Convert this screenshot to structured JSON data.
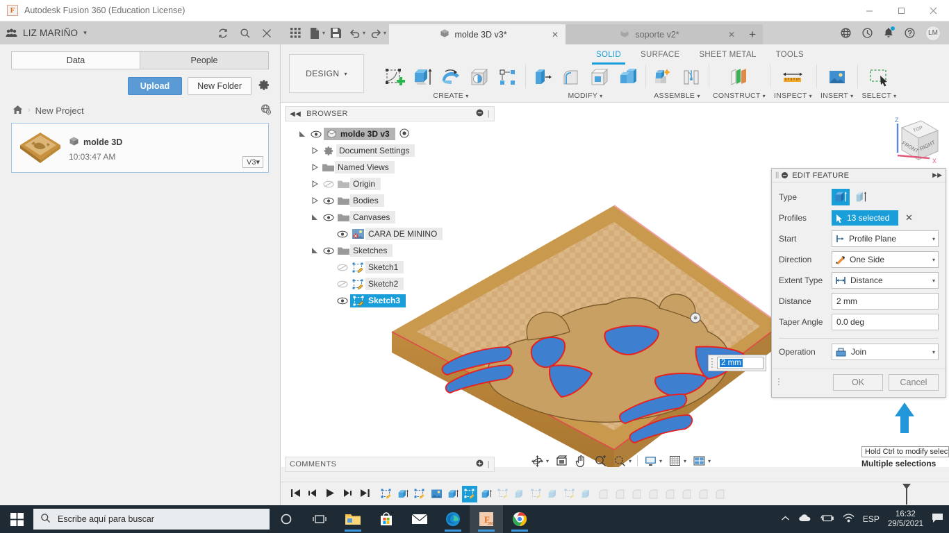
{
  "titlebar": {
    "app_title": "Autodesk Fusion 360 (Education License)",
    "logo_letter": "F",
    "minimize": "–",
    "maximize": "□",
    "close": "✕"
  },
  "data_panel": {
    "user_name": "LIZ MARIÑO",
    "caret": "▾",
    "tabs": [
      {
        "label": "Data",
        "active": true
      },
      {
        "label": "People",
        "active": false
      }
    ],
    "upload_label": "Upload",
    "new_folder_label": "New Folder",
    "breadcrumb": {
      "home_icon": "home-icon",
      "separator": "›",
      "project": "New Project"
    },
    "file": {
      "name": "molde 3D",
      "time": "10:03:47 AM",
      "version": "V3",
      "version_caret": "▾"
    }
  },
  "doc_tabs": {
    "tabs": [
      {
        "label": "molde 3D v3*",
        "active": true,
        "close": "✕"
      },
      {
        "label": "soporte v2*",
        "active": false,
        "close": "✕"
      }
    ],
    "add_tab": "+",
    "avatar_initials": "LM"
  },
  "ribbon": {
    "design_label": "DESIGN",
    "design_caret": "▾",
    "workspace_tabs": [
      {
        "label": "SOLID",
        "active": true
      },
      {
        "label": "SURFACE",
        "active": false
      },
      {
        "label": "SHEET METAL",
        "active": false
      },
      {
        "label": "TOOLS",
        "active": false
      }
    ],
    "groups": [
      {
        "label": "CREATE",
        "caret": "▾"
      },
      {
        "label": "MODIFY",
        "caret": "▾"
      },
      {
        "label": "ASSEMBLE",
        "caret": "▾"
      },
      {
        "label": "CONSTRUCT",
        "caret": "▾"
      },
      {
        "label": "INSPECT",
        "caret": "▾"
      },
      {
        "label": "INSERT",
        "caret": "▾"
      },
      {
        "label": "SELECT",
        "caret": "▾"
      }
    ]
  },
  "browser": {
    "title": "BROWSER",
    "collapse_icon": "◀◀",
    "nodes": [
      {
        "label": "molde 3D v3",
        "indent": 0,
        "state": "selected-gray"
      },
      {
        "label": "Document Settings",
        "indent": 1,
        "state": "normal"
      },
      {
        "label": "Named Views",
        "indent": 1,
        "state": "normal"
      },
      {
        "label": "Origin",
        "indent": 1,
        "state": "hidden"
      },
      {
        "label": "Bodies",
        "indent": 1,
        "state": "normal"
      },
      {
        "label": "Canvases",
        "indent": 1,
        "state": "normal"
      },
      {
        "label": "CARA DE MININO",
        "indent": 2,
        "state": "normal"
      },
      {
        "label": "Sketches",
        "indent": 1,
        "state": "normal"
      },
      {
        "label": "Sketch1",
        "indent": 2,
        "state": "hidden"
      },
      {
        "label": "Sketch2",
        "indent": 2,
        "state": "hidden"
      },
      {
        "label": "Sketch3",
        "indent": 2,
        "state": "selected-blue"
      }
    ]
  },
  "comments": {
    "title": "COMMENTS",
    "add_icon": "+"
  },
  "dialog": {
    "title": "EDIT FEATURE",
    "expand_icon": "▶▶",
    "rows": {
      "type_label": "Type",
      "profiles_label": "Profiles",
      "profiles_value": "13 selected",
      "profiles_clear": "✕",
      "start_label": "Start",
      "start_value": "Profile Plane",
      "direction_label": "Direction",
      "direction_value": "One Side",
      "extent_label": "Extent Type",
      "extent_value": "Distance",
      "distance_label": "Distance",
      "distance_value": "2 mm",
      "taper_label": "Taper Angle",
      "taper_value": "0.0 deg",
      "operation_label": "Operation",
      "operation_value": "Join"
    },
    "ok_label": "OK",
    "cancel_label": "Cancel",
    "caret": "▾"
  },
  "canvas": {
    "distance_input_value": "2 mm",
    "tooltip": "Hold Ctrl to modify select",
    "status_text": "Multiple selections",
    "viewcube": {
      "top": "TOP",
      "front": "FRONT",
      "right": "RIGHT",
      "axis_x": "X",
      "axis_z": "Z"
    }
  },
  "navbar": {
    "items": [
      {
        "icon": "orbit-icon",
        "caret": "▾"
      },
      {
        "icon": "look-at-icon",
        "caret": ""
      },
      {
        "icon": "pan-icon",
        "caret": ""
      },
      {
        "icon": "zoom-icon",
        "caret": ""
      },
      {
        "icon": "fit-icon",
        "caret": "▾"
      },
      {
        "icon": "display-settings-icon",
        "caret": "▾"
      },
      {
        "icon": "grid-snap-icon",
        "caret": "▾"
      },
      {
        "icon": "viewports-icon",
        "caret": "▾"
      }
    ]
  },
  "timeline": {
    "controls": [
      "skip-start-icon",
      "step-back-icon",
      "play-icon",
      "step-forward-icon",
      "skip-end-icon"
    ],
    "active_index": 5
  },
  "taskbar": {
    "search_placeholder": "Escribe aquí para buscar",
    "apps": [
      "file-explorer-icon",
      "microsoft-store-icon",
      "mail-icon",
      "edge-icon",
      "fusion360-icon",
      "chrome-icon"
    ],
    "language": "ESP",
    "time": "16:32",
    "date": "29/5/2021"
  },
  "colors": {
    "accent_blue": "#1a9ed9",
    "upload_blue": "#5b9bd5",
    "panel_gray": "#f0f0f0",
    "header_gray": "#cfcfcf",
    "model_tan": "#d9b380",
    "model_brown": "#c08b3e",
    "select_red": "#e83030",
    "taskbar_dark": "#1f2b34"
  }
}
